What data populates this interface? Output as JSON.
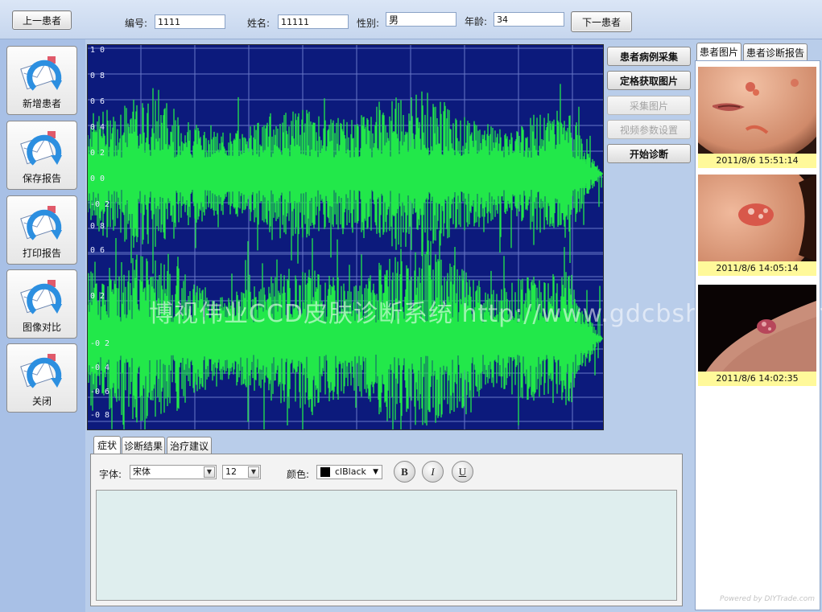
{
  "topbar": {
    "prev_label": "上一患者",
    "next_label": "下一患者",
    "id_label": "编号:",
    "id_value": "1111",
    "name_label": "姓名:",
    "name_value": "11111",
    "sex_label": "性别:",
    "sex_value": "男",
    "age_label": "年龄:",
    "age_value": "34"
  },
  "leftnav": {
    "items": [
      {
        "label": "新增患者"
      },
      {
        "label": "保存报告"
      },
      {
        "label": "打印报告"
      },
      {
        "label": "图像对比"
      },
      {
        "label": "关闭"
      }
    ]
  },
  "waveform": {
    "yticks": [
      "1 0",
      "0 8",
      "0 6",
      "0 4",
      "0 2",
      "0 0",
      "-0 2",
      "-0 4",
      "-0 6",
      "-0 8",
      "0 8",
      "0 6",
      "0 4",
      "0 2",
      "0 0",
      "-0 2",
      "-0 4",
      "-0 6",
      "-0 8"
    ],
    "wave_color": "#22e84a",
    "bg_color": "#0c1a7c"
  },
  "actions": {
    "capture_case": "患者病例采集",
    "freeze_image": "定格获取图片",
    "capture_image": "采集图片",
    "video_settings": "视频参数设置",
    "start_diagnosis": "开始诊断"
  },
  "rightpanel": {
    "tabs": [
      "患者图片",
      "患者诊断报告"
    ],
    "thumbnails": [
      {
        "caption": "2011/8/6 15:51:14"
      },
      {
        "caption": "2011/8/6 14:05:14"
      },
      {
        "caption": "2011/8/6 14:02:35"
      }
    ],
    "powered": "Powered by DIYTrade.com"
  },
  "editor": {
    "tabs": [
      "症状",
      "诊断结果",
      "治疗建议"
    ],
    "font_label": "字体:",
    "font_value": "宋体",
    "size_value": "12",
    "color_label": "颜色:",
    "color_value": "clBlack",
    "bold": "B",
    "italic": "I",
    "underline": "U"
  },
  "watermark": "博视伟业CCD皮肤诊断系统 http://www.gdcbshotline.com"
}
